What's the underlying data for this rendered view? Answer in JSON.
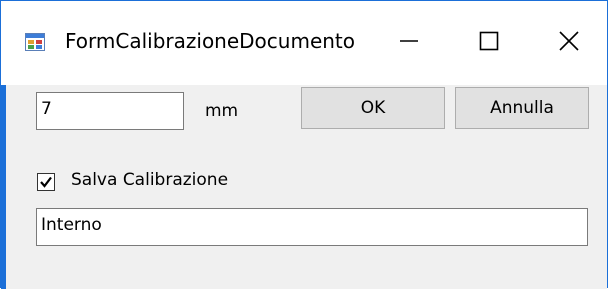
{
  "window": {
    "title": "FormCalibrazioneDocumento",
    "icon": "winforms-app-icon",
    "controls": {
      "minimize_icon": "minimize-icon",
      "maximize_icon": "maximize-icon",
      "close_icon": "close-icon"
    }
  },
  "form": {
    "measure_value": "7",
    "measure_unit": "mm",
    "ok_label": "OK",
    "cancel_label": "Annulla",
    "save_calibration_label": "Salva Calibrazione",
    "save_calibration_checked": true,
    "source_value": "Interno"
  },
  "colors": {
    "window_border": "#1b6fd8",
    "client_background": "#f0f0f0",
    "button_background": "#e1e1e1"
  }
}
